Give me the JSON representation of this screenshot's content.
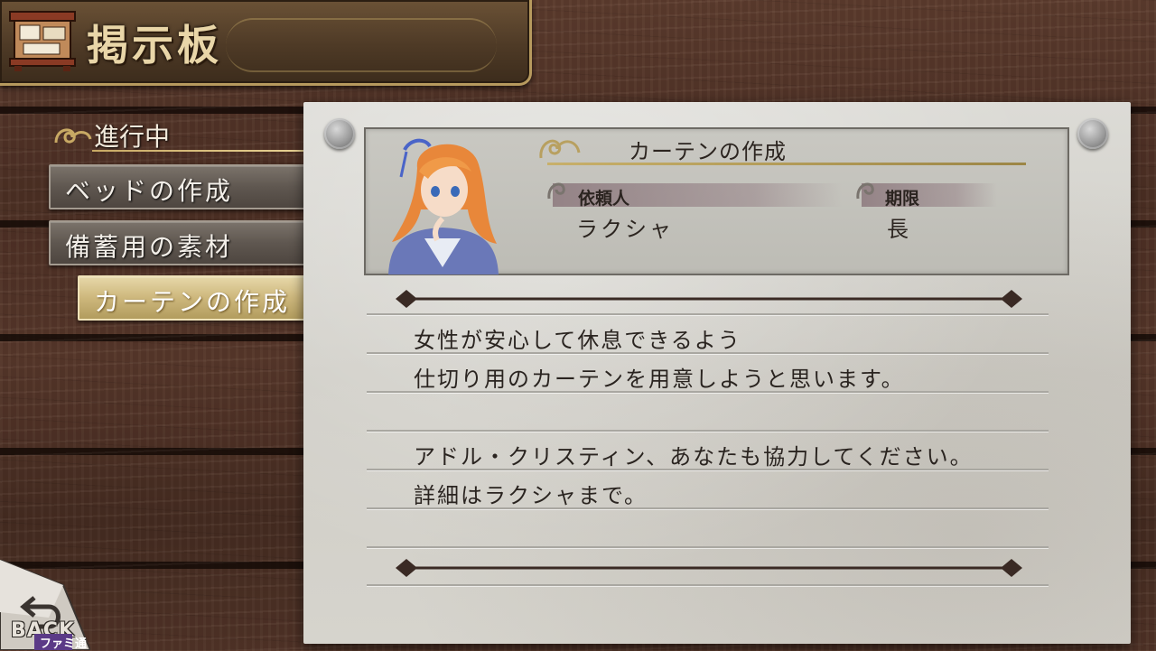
{
  "header": {
    "title": "掲示板",
    "icon": "bulletin-board-icon"
  },
  "sidebar": {
    "section_label": "進行中",
    "items": [
      {
        "label": "ベッドの作成",
        "active": false
      },
      {
        "label": "備蓄用の素材",
        "active": false
      },
      {
        "label": "カーテンの作成",
        "active": true
      }
    ]
  },
  "quest": {
    "title": "カーテンの作成",
    "client_label": "依頼人",
    "client_value": "ラクシャ",
    "deadline_label": "期限",
    "deadline_value": "長",
    "body": [
      "女性が安心して休息できるよう",
      "仕切り用のカーテンを用意しようと思います。",
      "",
      "アドル・クリスティン、あなたも協力してください。",
      "詳細はラクシャまで。"
    ]
  },
  "back": {
    "label": "BACK"
  },
  "watermark": {
    "text": "ファミ通"
  },
  "colors": {
    "wood": "#4e3226",
    "paper": "#d6d4cd",
    "accent_gold": "#c8b06a",
    "active_button": "#cdb77c"
  }
}
